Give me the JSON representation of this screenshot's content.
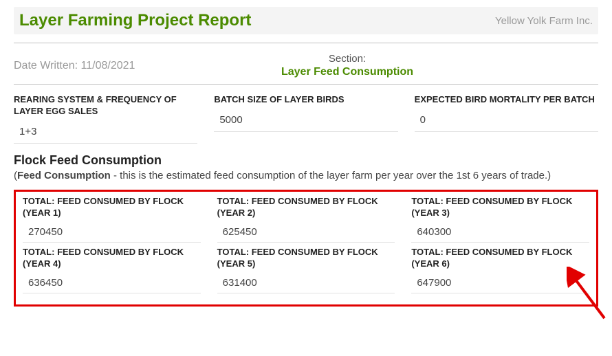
{
  "header": {
    "title": "Layer Farming Project Report",
    "company": "Yellow Yolk Farm Inc."
  },
  "meta": {
    "date_label": "Date Written: 11/08/2021",
    "section_label": "Section:",
    "section_name": "Layer Feed Consumption"
  },
  "top_fields": [
    {
      "label": "REARING SYSTEM & FREQUENCY OF LAYER EGG SALES",
      "value": "1+3"
    },
    {
      "label": "BATCH SIZE OF LAYER BIRDS",
      "value": "5000"
    },
    {
      "label": "EXPECTED BIRD MORTALITY PER BATCH",
      "value": "0"
    }
  ],
  "flock": {
    "heading": "Flock Feed Consumption",
    "desc_bold": "Feed Consumption",
    "desc_rest": " - this is the estimated feed consumption of the layer farm per year over the 1st 6 years of trade.)",
    "desc_open": "("
  },
  "years": [
    {
      "label": "TOTAL: FEED CONSUMED BY FLOCK (YEAR 1)",
      "value": "270450"
    },
    {
      "label": "TOTAL: FEED CONSUMED BY FLOCK (YEAR 2)",
      "value": "625450"
    },
    {
      "label": "TOTAL: FEED CONSUMED BY FLOCK (YEAR 3)",
      "value": "640300"
    },
    {
      "label": "TOTAL: FEED CONSUMED BY FLOCK (YEAR 4)",
      "value": "636450"
    },
    {
      "label": "TOTAL: FEED CONSUMED BY FLOCK (YEAR 5)",
      "value": "631400"
    },
    {
      "label": "TOTAL: FEED CONSUMED BY FLOCK (YEAR 6)",
      "value": "647900"
    }
  ]
}
